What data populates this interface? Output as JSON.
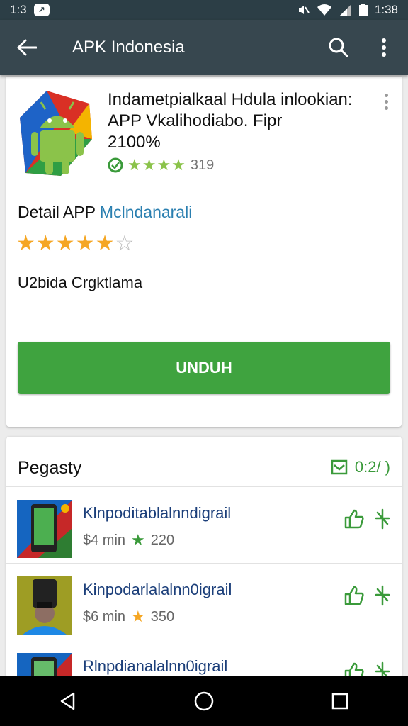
{
  "status_bar": {
    "time": "1:3",
    "right_time": "1:38"
  },
  "app_bar": {
    "title": "APK Indonesia"
  },
  "app": {
    "title_line1": "Indametpialkaal Hdula inlookian:",
    "title_line2": "APP Vkalihodiabo. Fipr",
    "title_line3": "2100%",
    "rating_count": "319",
    "small_stars": "★★★★",
    "detail_prefix": "Detail APP",
    "detail_accent": "Mclndanarali",
    "size_text": "U2bida Crgktlama",
    "download_label": "UNDUH"
  },
  "section": {
    "title": "Pegasty",
    "action_label": "0:2/ )"
  },
  "list": [
    {
      "name": "Klnpoditablalnndigrail",
      "price": "$4 min",
      "count": "220",
      "star_color": "#3a9a3a"
    },
    {
      "name": "Kinpodarlalalnn0igrail",
      "price": "$6 min",
      "count": "350",
      "star_color": "#f5a623"
    },
    {
      "name": "Rlnpdianalalnn0igrail",
      "price": "",
      "count": "",
      "star_color": "#3a9a3a"
    }
  ],
  "colors": {
    "primary": "#37474f",
    "accent_green": "#3fa33f",
    "star_orange": "#f5a623"
  }
}
